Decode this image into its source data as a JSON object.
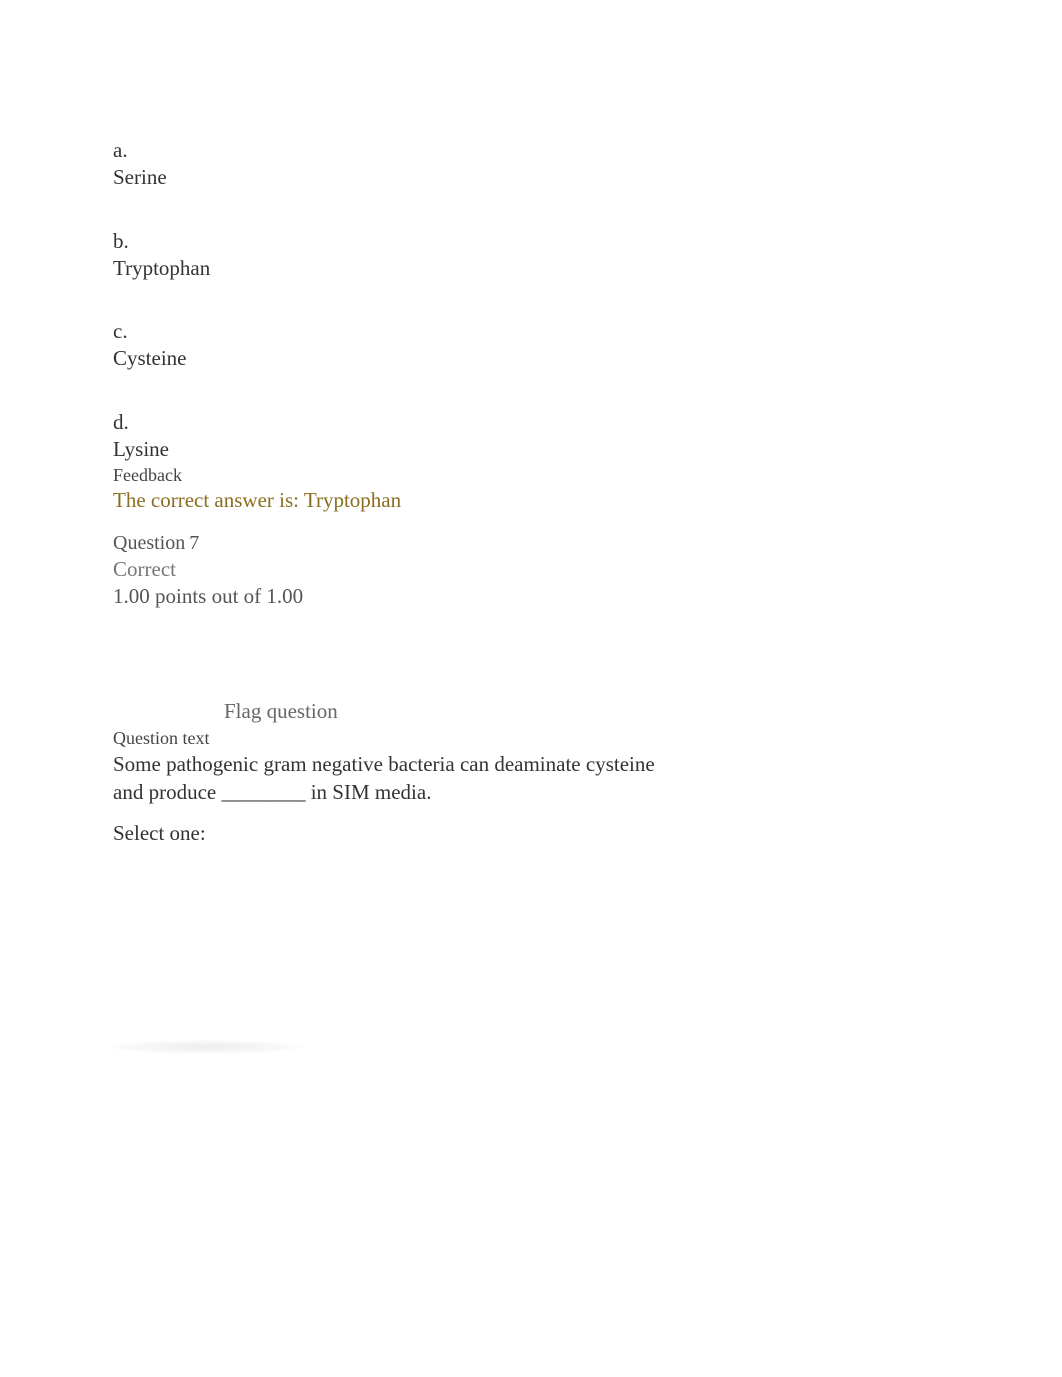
{
  "q6": {
    "options": [
      {
        "letter": "a.",
        "text": "Serine"
      },
      {
        "letter": "b.",
        "text": "Tryptophan"
      },
      {
        "letter": "c.",
        "text": "Cysteine"
      },
      {
        "letter": "d.",
        "text": "Lysine"
      }
    ],
    "feedback_label": "Feedback",
    "feedback_answer": "The correct answer is: Tryptophan"
  },
  "q7": {
    "question_label": "Question",
    "question_number": "7",
    "status": "Correct",
    "points": "1.00 points out of 1.00",
    "flag": "Flag question",
    "question_text_label": "Question text",
    "question_text": "Some pathogenic gram negative bacteria can deaminate cysteine and produce ________ in SIM media.",
    "select_one": "Select one:"
  }
}
